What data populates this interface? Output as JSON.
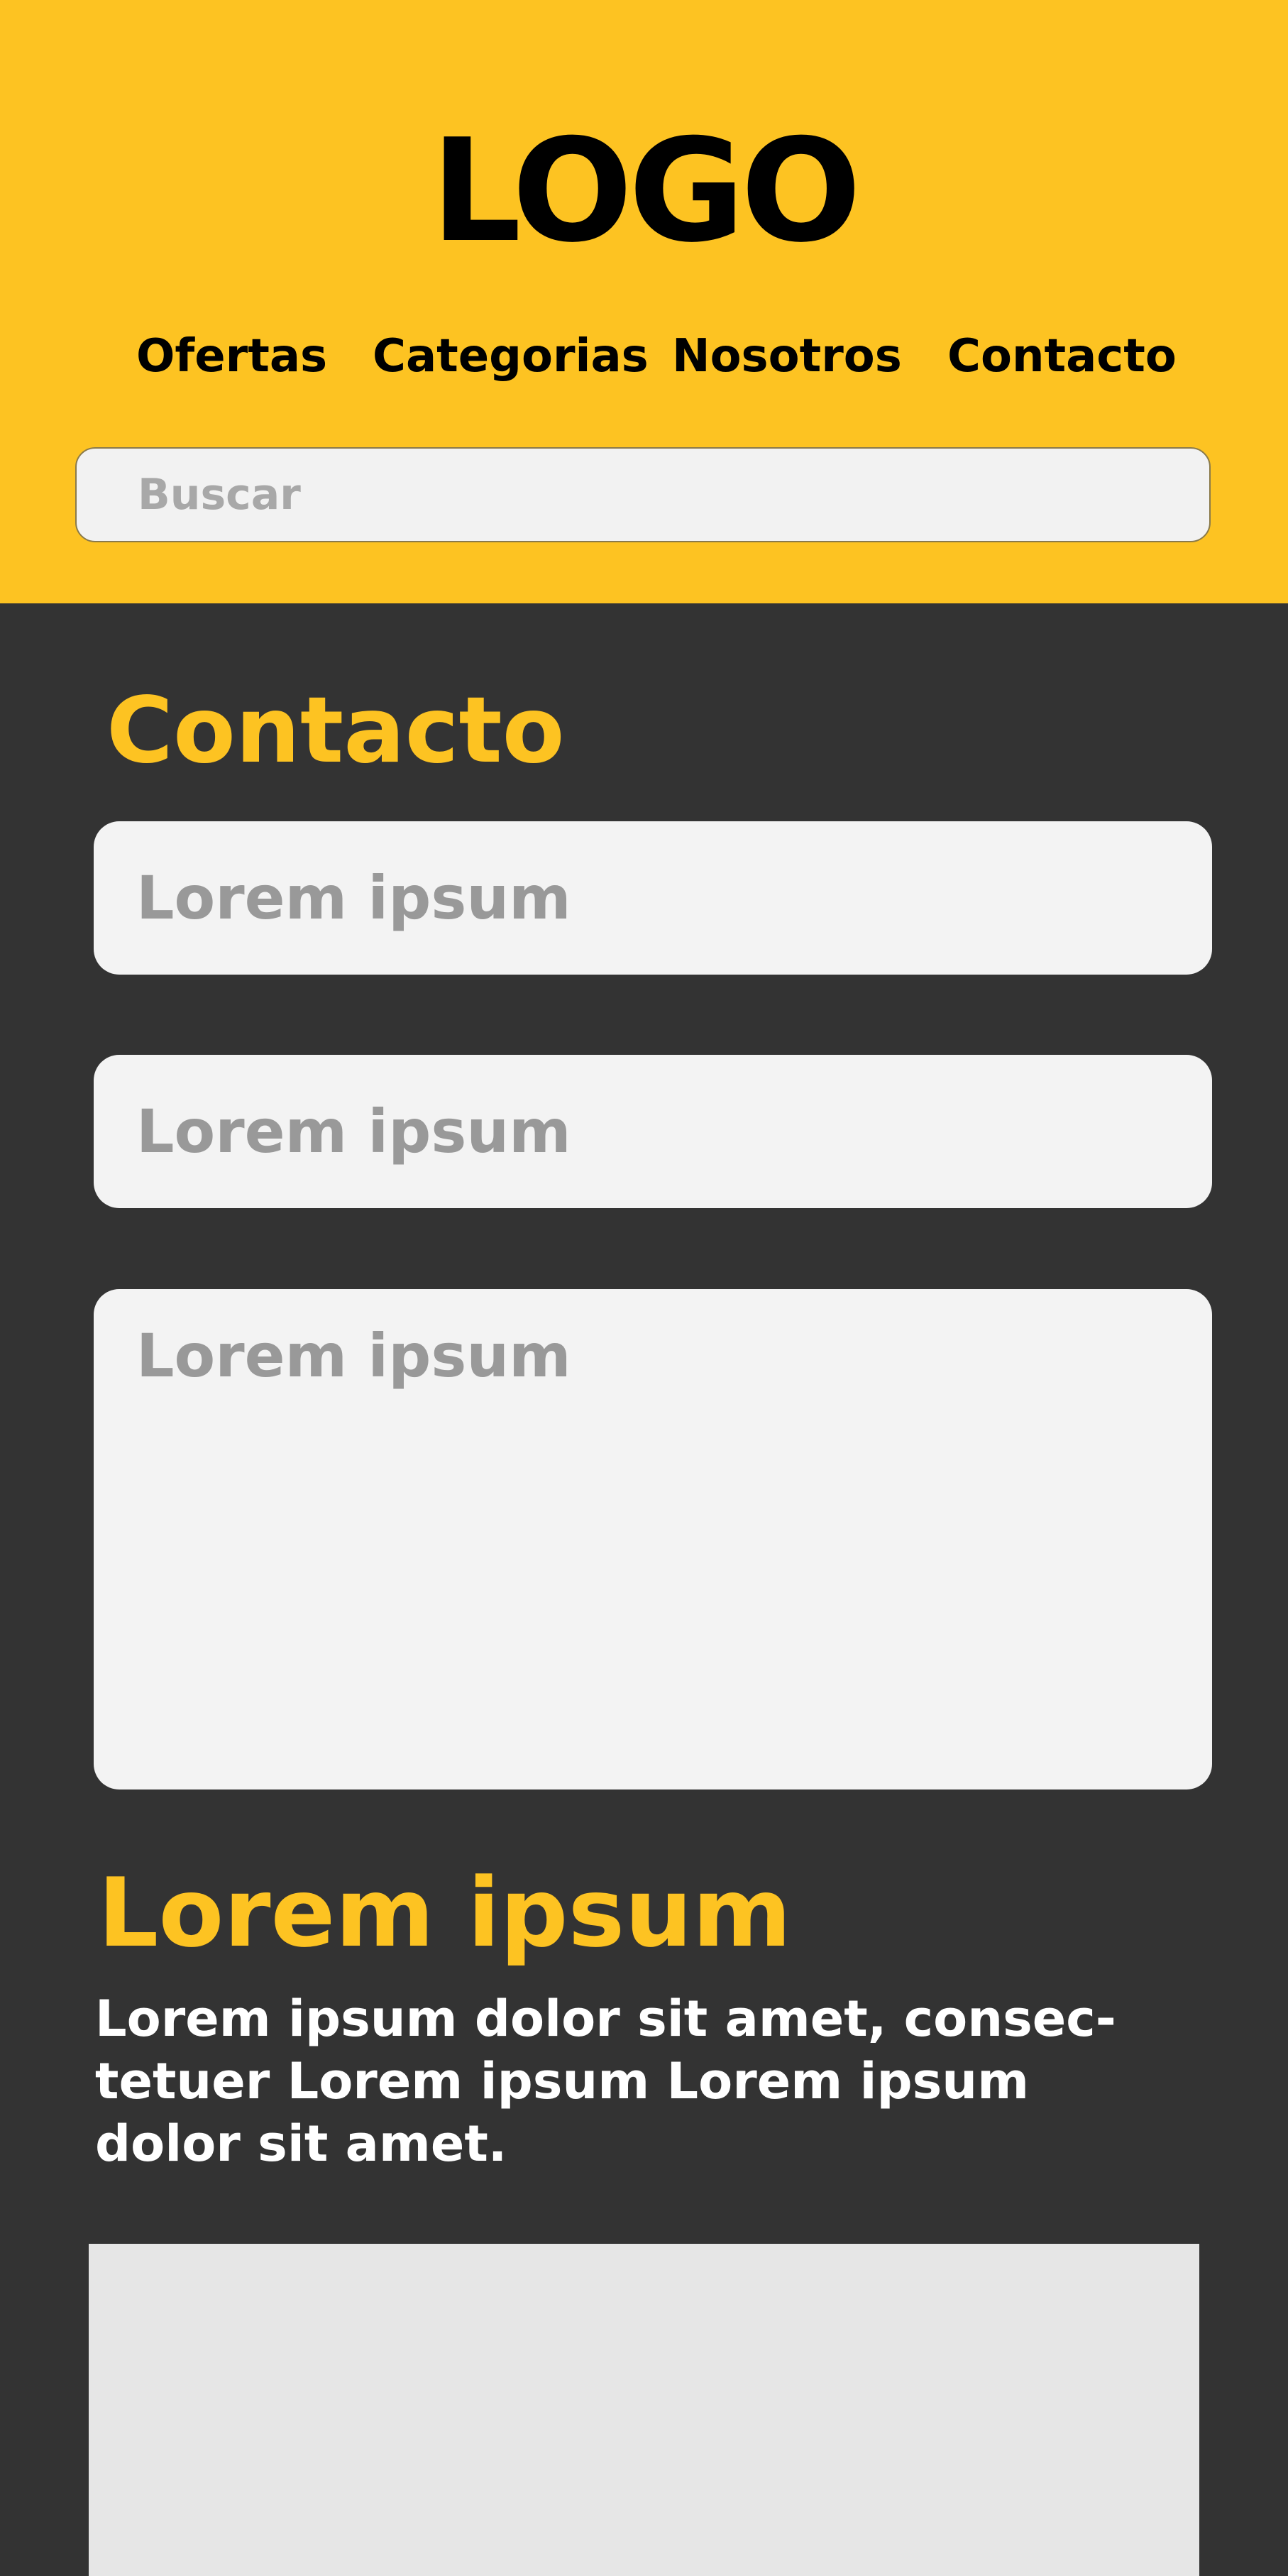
{
  "header": {
    "logo": "LOGO",
    "nav": [
      {
        "label": "Ofertas"
      },
      {
        "label": "Categorias"
      },
      {
        "label": "Nosotros"
      },
      {
        "label": "Contacto"
      }
    ],
    "search": {
      "placeholder": "Buscar",
      "value": ""
    }
  },
  "contact": {
    "title": "Contacto",
    "fields": [
      {
        "placeholder": "Lorem ipsum",
        "value": ""
      },
      {
        "placeholder": "Lorem ipsum",
        "value": ""
      },
      {
        "placeholder": "Lorem ipsum",
        "value": ""
      }
    ]
  },
  "info": {
    "title": "Lorem ipsum",
    "text": "Lorem ipsum dolor sit amet, consec-tetuer Lorem ipsum Lorem ipsum dolor sit amet."
  },
  "colors": {
    "accent": "#fdc322",
    "background": "#333333",
    "field": "#f3f3f3",
    "image_placeholder": "#e6e6e6"
  }
}
